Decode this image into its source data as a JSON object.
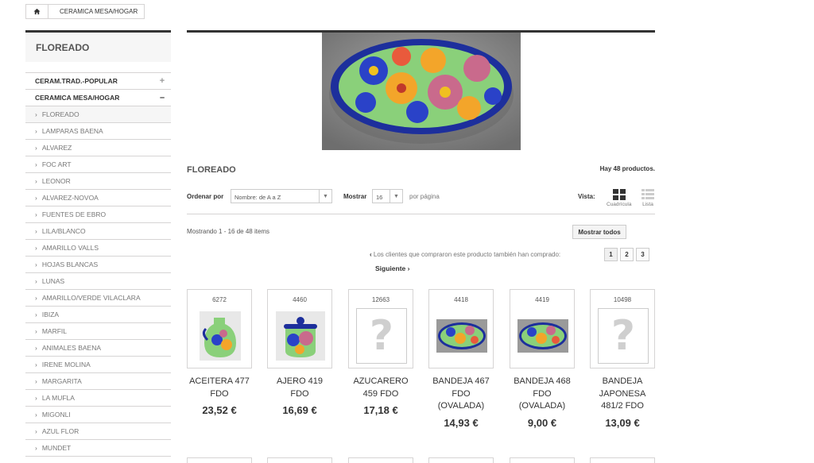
{
  "breadcrumb": {
    "home_icon": "home-icon",
    "current": "CERAMICA MESA/HOGAR"
  },
  "sidebar": {
    "title": "FLOREADO",
    "top_categories": [
      {
        "label": "CERAM.TRAD.-POPULAR",
        "toggle": "+"
      },
      {
        "label": "CERAMICA MESA/HOGAR",
        "toggle": "–"
      }
    ],
    "subcategories": [
      "FLOREADO",
      "LAMPARAS BAENA",
      "ALVAREZ",
      "FOC ART",
      "LEONOR",
      "ALVAREZ-NOVOA",
      "FUENTES DE EBRO",
      "LILA/BLANCO",
      "AMARILLO VALLS",
      "HOJAS BLANCAS",
      "LUNAS",
      "AMARILLO/VERDE VILACLARA",
      "IBIZA",
      "MARFIL",
      "ANIMALES BAENA",
      "IRENE MOLINA",
      "MARGARITA",
      "LA MUFLA",
      "MIGONLI",
      "AZUL FLOR",
      "MUNDET"
    ],
    "active_index": 0,
    "colors": {
      "accent": "#333333",
      "active_bg": "#f6f6f6"
    }
  },
  "category": {
    "title": "FLOREADO",
    "count_text": "Hay 48 productos.",
    "sort": {
      "label": "Ordenar por",
      "value": "Nombre: de A a Z"
    },
    "show": {
      "label": "Mostrar",
      "value": "16",
      "suffix": "por página"
    },
    "view": {
      "label": "Vista:",
      "grid": "Cuadrícula",
      "list": "Lista"
    },
    "showing_text": "Mostrando 1 - 16 de 48 items",
    "show_all": "Mostrar todos",
    "pager_text": "Los clientes que compraron este producto también han comprado:",
    "pages": [
      "1",
      "2",
      "3"
    ],
    "next": "Siguiente"
  },
  "products": [
    {
      "ref": "6272",
      "name": "ACEITERA 477 FDO",
      "price": "23,52 €",
      "image": "jug"
    },
    {
      "ref": "4460",
      "name": "AJERO 419 FDO",
      "price": "16,69 €",
      "image": "jar"
    },
    {
      "ref": "12663",
      "name": "AZUCARERO 459 FDO",
      "price": "17,18 €",
      "image": "placeholder"
    },
    {
      "ref": "4418",
      "name": "BANDEJA 467 FDO (OVALADA)",
      "price": "14,93 €",
      "image": "oval"
    },
    {
      "ref": "4419",
      "name": "BANDEJA 468 FDO (OVALADA)",
      "price": "9,00 €",
      "image": "oval"
    },
    {
      "ref": "10498",
      "name": "BANDEJA JAPONESA 481/2 FDO",
      "price": "13,09 €",
      "image": "placeholder"
    }
  ]
}
